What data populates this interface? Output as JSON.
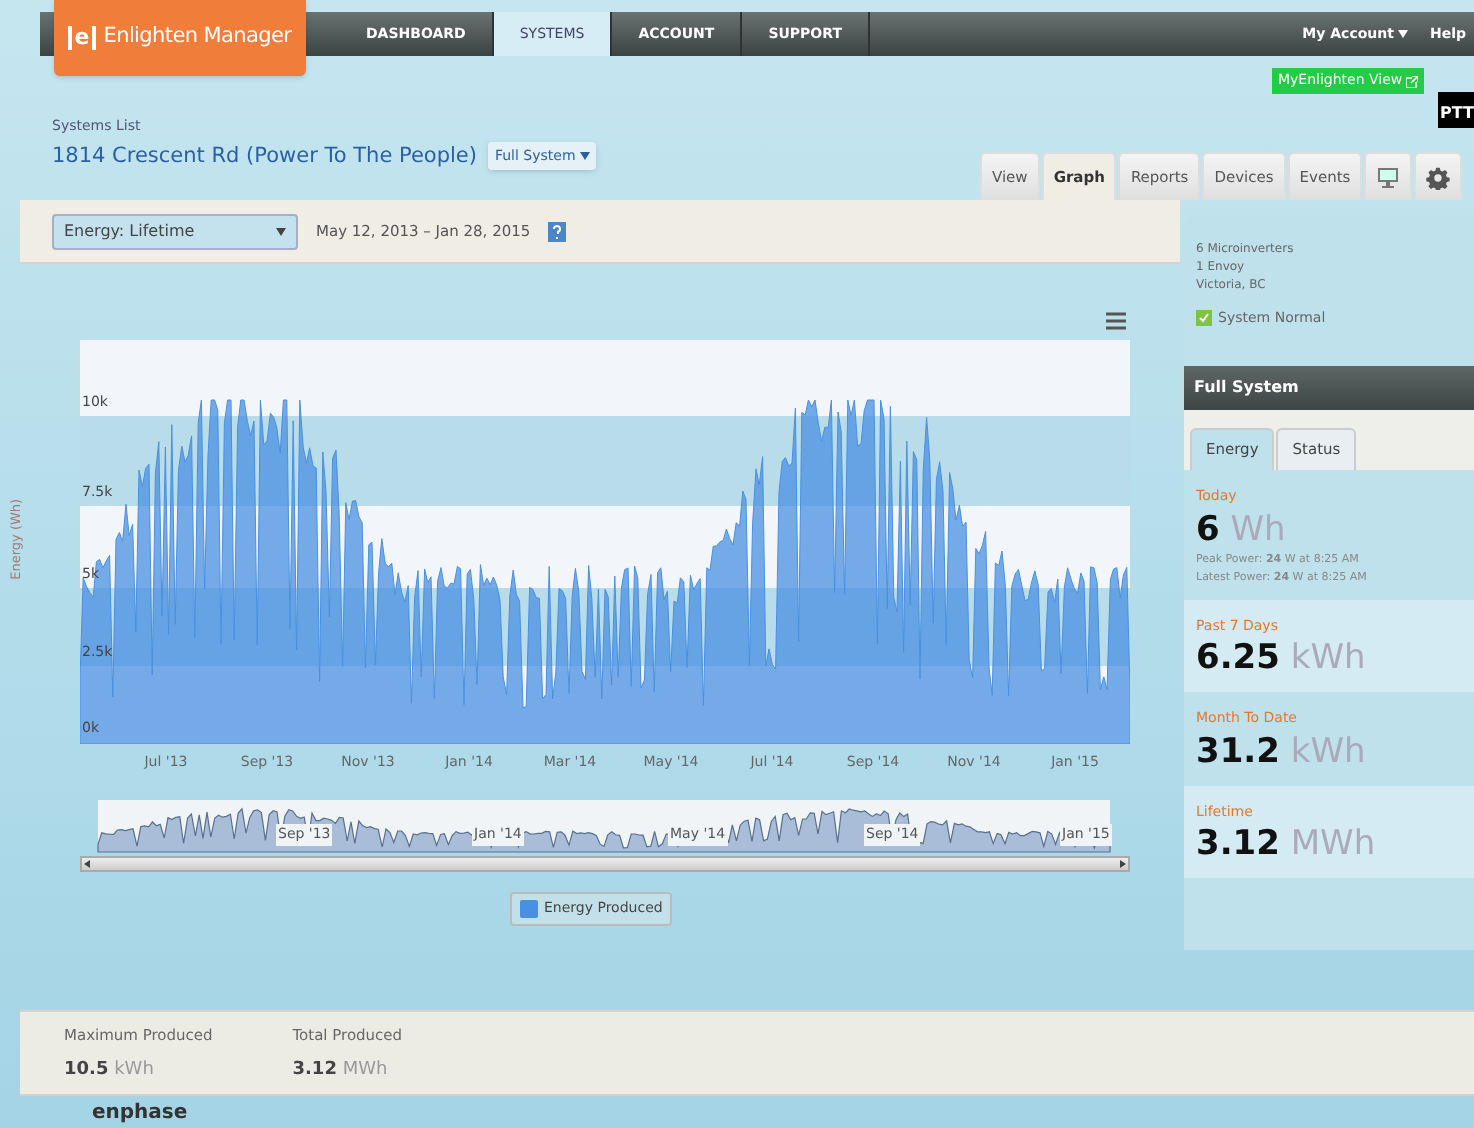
{
  "header": {
    "logo_mark": "e",
    "logo_text": "Enlighten Manager",
    "nav": [
      {
        "label": "DASHBOARD",
        "selected": false
      },
      {
        "label": "SYSTEMS",
        "selected": true
      },
      {
        "label": "ACCOUNT",
        "selected": false
      },
      {
        "label": "SUPPORT",
        "selected": false
      }
    ],
    "account_menu": "My Account",
    "help": "Help"
  },
  "myenlighten_button": "MyEnlighten View",
  "brand_badge": "PTT",
  "breadcrumb": "Systems List",
  "title": "1814 Crescent Rd (Power To The People)",
  "scope_dropdown": "Full System",
  "view_tabs": [
    {
      "kind": "text",
      "label": "View",
      "selected": false
    },
    {
      "kind": "text",
      "label": "Graph",
      "selected": true
    },
    {
      "kind": "text",
      "label": "Reports",
      "selected": false
    },
    {
      "kind": "text",
      "label": "Devices",
      "selected": false
    },
    {
      "kind": "text",
      "label": "Events",
      "selected": false
    },
    {
      "kind": "monitor",
      "selected": false
    },
    {
      "kind": "gear",
      "selected": false
    }
  ],
  "toolbar": {
    "range_select": "Energy: Lifetime",
    "date_range": "May 12, 2013 – Jan 28, 2015"
  },
  "chart": {
    "ylabel": "Energy (Wh)",
    "yticks": [
      "10k",
      "7.5k",
      "5k",
      "2.5k",
      "0k"
    ],
    "xticks": [
      "Jul '13",
      "Sep '13",
      "Nov '13",
      "Jan '14",
      "Mar '14",
      "May '14",
      "Jul '14",
      "Sep '14",
      "Nov '14",
      "Jan '15"
    ],
    "navigator_ticks": [
      "Sep '13",
      "Jan '14",
      "May '14",
      "Sep '14",
      "Jan '15"
    ],
    "legend": {
      "label": "Energy Produced",
      "color": "#4a90e2"
    }
  },
  "system_info": {
    "lines": [
      "6 Microinverters",
      "1 Envoy",
      "Victoria, BC"
    ],
    "status": {
      "label": "System Normal",
      "checked": true
    }
  },
  "panel": {
    "title": "Full System",
    "tabs": [
      {
        "label": "Energy",
        "selected": true
      },
      {
        "label": "Status",
        "selected": false
      }
    ],
    "stats": [
      {
        "label": "Today",
        "value": "6",
        "unit": "Wh",
        "notes": [
          "Peak Power: **24** W at 8:25 AM",
          "Latest Power: **24** W at 8:25 AM"
        ]
      },
      {
        "label": "Past 7 Days",
        "value": "6.25",
        "unit": "kWh"
      },
      {
        "label": "Month To Date",
        "value": "31.2",
        "unit": "kWh"
      },
      {
        "label": "Lifetime",
        "value": "3.12",
        "unit": "MWh"
      }
    ]
  },
  "summary": [
    {
      "label": "Maximum Produced",
      "value": "10.5",
      "unit": "kWh"
    },
    {
      "label": "Total Produced",
      "value": "3.12",
      "unit": "MWh"
    }
  ],
  "footer_logo": "enphase"
}
